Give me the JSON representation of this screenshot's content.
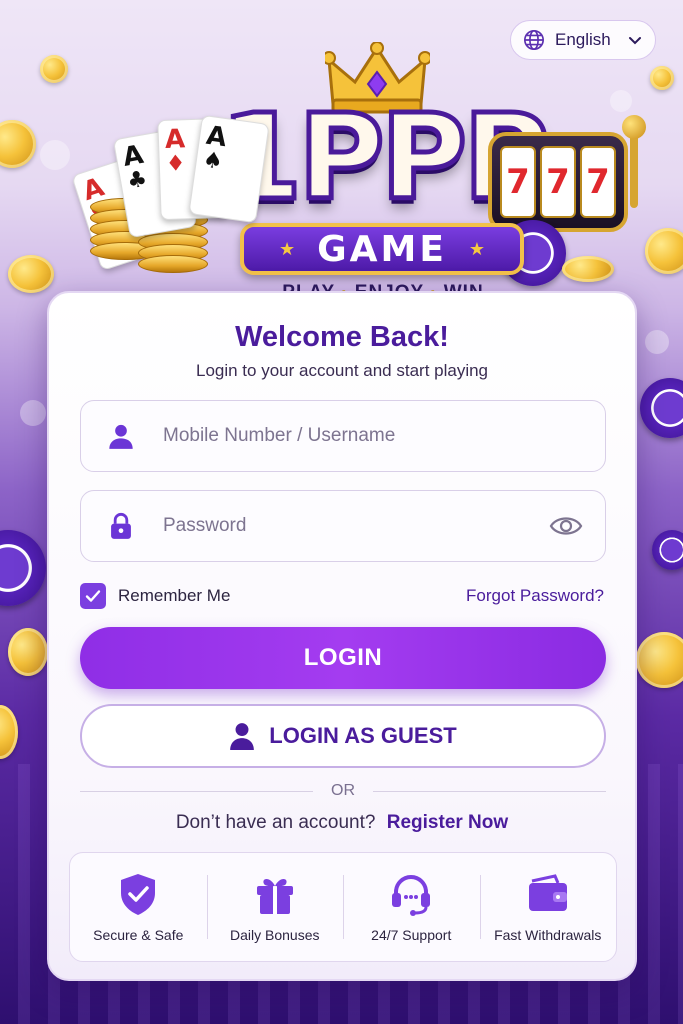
{
  "language": {
    "label": "English"
  },
  "logo": {
    "brand": "1PPP",
    "banner": "GAME",
    "tagline": [
      "PLAY",
      "ENJOY",
      "WIN"
    ],
    "slot_symbols": [
      "7",
      "7",
      "7"
    ],
    "cards": [
      {
        "rank": "A",
        "suit": "♥",
        "color": "red"
      },
      {
        "rank": "A",
        "suit": "♣",
        "color": "blk"
      },
      {
        "rank": "A",
        "suit": "♦",
        "color": "red"
      },
      {
        "rank": "A",
        "suit": "♠",
        "color": "blk"
      }
    ]
  },
  "login": {
    "title": "Welcome Back!",
    "subtitle": "Login to your account and start playing",
    "username": {
      "placeholder": "Mobile Number / Username",
      "value": ""
    },
    "password": {
      "placeholder": "Password",
      "value": ""
    },
    "remember_label": "Remember Me",
    "remember_checked": true,
    "forgot_label": "Forgot Password?",
    "login_button": "LOGIN",
    "guest_button": "LOGIN AS GUEST",
    "divider": "OR",
    "register_prompt": "Don’t have an account?",
    "register_link": "Register Now"
  },
  "features": [
    {
      "icon": "shield-check-icon",
      "label": "Secure & Safe"
    },
    {
      "icon": "gift-icon",
      "label": "Daily Bonuses"
    },
    {
      "icon": "headset-icon",
      "label": "24/7 Support"
    },
    {
      "icon": "wallet-icon",
      "label": "Fast Withdrawals"
    }
  ],
  "colors": {
    "accent": "#8f2ee6",
    "primary_text": "#4a1c9c",
    "gold": "#f2c14a"
  }
}
